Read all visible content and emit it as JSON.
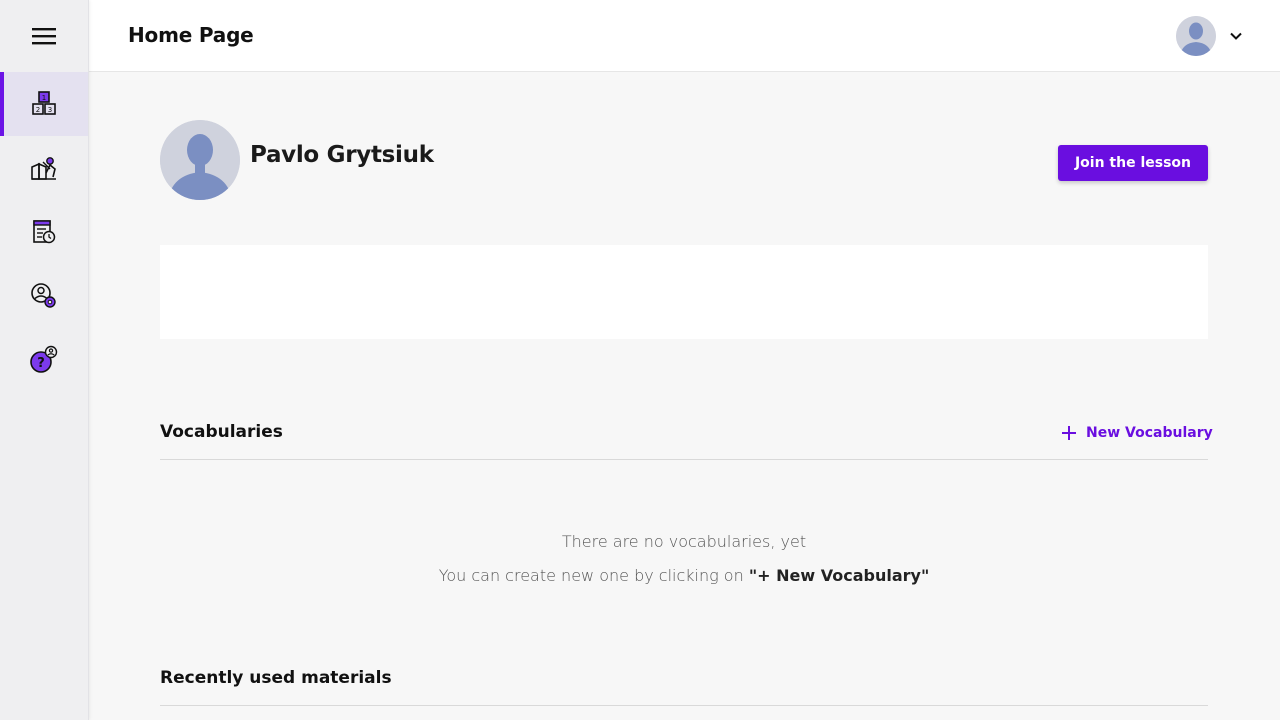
{
  "header": {
    "title": "Home Page",
    "avatar_icon": "user-avatar-icon",
    "menu_icon": "chevron-down-icon"
  },
  "sidebar": {
    "menu_icon": "hamburger-icon",
    "items": [
      {
        "icon": "blocks-icon",
        "active": true
      },
      {
        "icon": "teacher-icon",
        "active": false
      },
      {
        "icon": "schedule-icon",
        "active": false
      },
      {
        "icon": "user-settings-icon",
        "active": false
      },
      {
        "icon": "help-icon",
        "active": false
      }
    ]
  },
  "profile": {
    "name": "Pavlo Grytsiuk",
    "join_label": "Join the lesson"
  },
  "vocabularies": {
    "title": "Vocabularies",
    "new_label": "New Vocabulary",
    "empty_line_1": "There are no vocabularies, yet",
    "empty_line_2_prefix": "You can create new one by clicking on ",
    "empty_line_2_emphasis": "\"+ New Vocabulary\""
  },
  "recent": {
    "title": "Recently used materials"
  },
  "colors": {
    "accent": "#6a0ee0",
    "sidebar_bg": "#efeff1",
    "active_bg": "#e4e1f0",
    "page_bg": "#f7f7f7",
    "avatar_bg": "#cfd2dd",
    "avatar_fg": "#7b8fc2"
  }
}
